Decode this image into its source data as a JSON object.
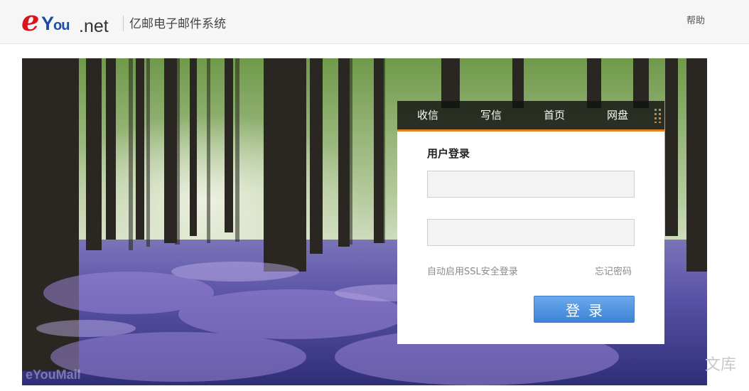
{
  "header": {
    "logo": {
      "e": "e",
      "y": "Y",
      "ou": "ou",
      "net": ".net"
    },
    "product_name": "亿邮电子邮件系统",
    "help": "帮助"
  },
  "nav": {
    "inbox": "收信",
    "compose": "写信",
    "home": "首页",
    "netdisk": "网盘",
    "more_icon": "grid-dots-icon"
  },
  "login": {
    "title": "用户登录",
    "username": {
      "value": "",
      "placeholder": ""
    },
    "password": {
      "value": "",
      "placeholder": ""
    },
    "ssl_label": "自动启用SSL安全登录",
    "forgot_password": "忘记密码",
    "submit": "登录"
  },
  "watermarks": {
    "left": "eYouMail",
    "right": "文库"
  },
  "colors": {
    "accent": "#e47d1f",
    "button": "#3d83d6",
    "logo_red": "#d8141c",
    "logo_blue": "#1b4da8"
  }
}
